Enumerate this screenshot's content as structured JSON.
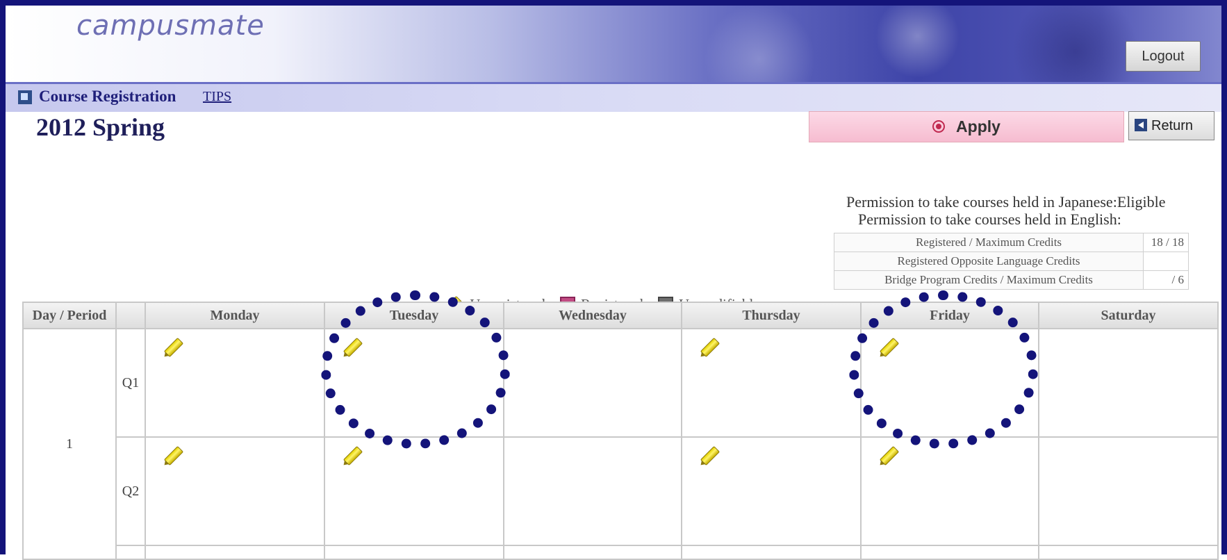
{
  "header": {
    "logo": "campusmate",
    "logout_label": "Logout"
  },
  "titlebar": {
    "title": "Course Registration",
    "tips_label": "TIPS"
  },
  "term": "2012 Spring",
  "actions": {
    "apply_label": "Apply",
    "return_label": "Return"
  },
  "permissions": {
    "japanese_label": "Permission to take courses held in Japanese:",
    "japanese_value": "Eligible",
    "english_label": "Permission to take courses held in English:",
    "english_value": ""
  },
  "credits": [
    {
      "label": "Registered / Maximum Credits",
      "value": "18 / 18"
    },
    {
      "label": "Registered Opposite Language Credits",
      "value": ""
    },
    {
      "label": "Bridge Program Credits / Maximum Credits",
      "value": " / 6"
    }
  ],
  "legend": {
    "unregistered": "Unregistered",
    "registered": "Registered",
    "unmodifiable": "Unmodifiable"
  },
  "timetable": {
    "corner_header": "Day / Period",
    "days": [
      "Monday",
      "Tuesday",
      "Wednesday",
      "Thursday",
      "Friday",
      "Saturday"
    ],
    "period": "1",
    "quarters": [
      "Q1",
      "Q2"
    ],
    "cells": {
      "Q1": [
        "unregistered",
        "unregistered",
        "",
        "unregistered",
        "unregistered",
        ""
      ],
      "Q2": [
        "unregistered",
        "unregistered",
        "",
        "unregistered",
        "unregistered",
        ""
      ]
    }
  },
  "annotations": {
    "highlighted_days": [
      "Tuesday",
      "Friday"
    ],
    "circle_color": "#14147a"
  },
  "colors": {
    "frame": "#14147a",
    "apply_bg": "#f6bcd0",
    "title_text": "#1f1f7a"
  }
}
